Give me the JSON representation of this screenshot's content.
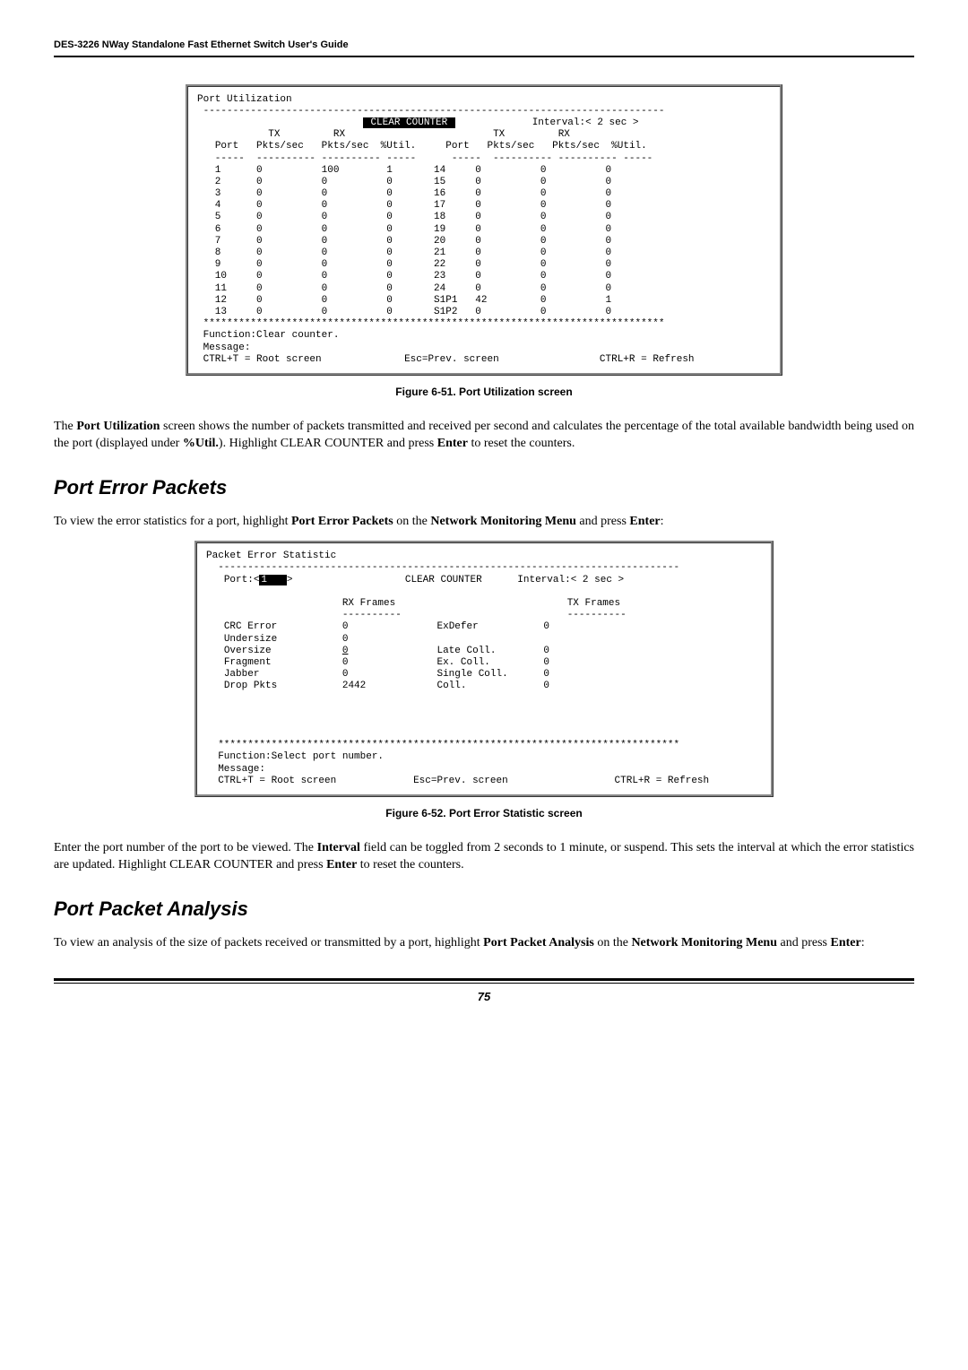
{
  "header": "DES-3226 NWay Standalone Fast Ethernet Switch User's Guide",
  "terminal1": {
    "title": "Port Utilization",
    "hdr_clear": " CLEAR COUNTER ",
    "hdr_interval": "Interval:< 2 sec >",
    "col_tx": "TX",
    "col_rx": "RX",
    "col_port": "Port",
    "col_pktssec": "Pkts/sec",
    "col_util": "%Util.",
    "rows_left": [
      {
        "p": "1",
        "tx": "0",
        "rx": "100",
        "u": "1"
      },
      {
        "p": "2",
        "tx": "0",
        "rx": "0",
        "u": "0"
      },
      {
        "p": "3",
        "tx": "0",
        "rx": "0",
        "u": "0"
      },
      {
        "p": "4",
        "tx": "0",
        "rx": "0",
        "u": "0"
      },
      {
        "p": "5",
        "tx": "0",
        "rx": "0",
        "u": "0"
      },
      {
        "p": "6",
        "tx": "0",
        "rx": "0",
        "u": "0"
      },
      {
        "p": "7",
        "tx": "0",
        "rx": "0",
        "u": "0"
      },
      {
        "p": "8",
        "tx": "0",
        "rx": "0",
        "u": "0"
      },
      {
        "p": "9",
        "tx": "0",
        "rx": "0",
        "u": "0"
      },
      {
        "p": "10",
        "tx": "0",
        "rx": "0",
        "u": "0"
      },
      {
        "p": "11",
        "tx": "0",
        "rx": "0",
        "u": "0"
      },
      {
        "p": "12",
        "tx": "0",
        "rx": "0",
        "u": "0"
      },
      {
        "p": "13",
        "tx": "0",
        "rx": "0",
        "u": "0"
      }
    ],
    "rows_right": [
      {
        "p": "14",
        "tx": "0",
        "rx": "0",
        "u": "0"
      },
      {
        "p": "15",
        "tx": "0",
        "rx": "0",
        "u": "0"
      },
      {
        "p": "16",
        "tx": "0",
        "rx": "0",
        "u": "0"
      },
      {
        "p": "17",
        "tx": "0",
        "rx": "0",
        "u": "0"
      },
      {
        "p": "18",
        "tx": "0",
        "rx": "0",
        "u": "0"
      },
      {
        "p": "19",
        "tx": "0",
        "rx": "0",
        "u": "0"
      },
      {
        "p": "20",
        "tx": "0",
        "rx": "0",
        "u": "0"
      },
      {
        "p": "21",
        "tx": "0",
        "rx": "0",
        "u": "0"
      },
      {
        "p": "22",
        "tx": "0",
        "rx": "0",
        "u": "0"
      },
      {
        "p": "23",
        "tx": "0",
        "rx": "0",
        "u": "0"
      },
      {
        "p": "24",
        "tx": "0",
        "rx": "0",
        "u": "0"
      },
      {
        "p": "S1P1",
        "tx": "42",
        "rx": "0",
        "u": "1"
      },
      {
        "p": "S1P2",
        "tx": "0",
        "rx": "0",
        "u": "0"
      }
    ],
    "func": "Function:Clear counter.",
    "msg": "Message:",
    "foot_left": "CTRL+T = Root screen",
    "foot_mid": "Esc=Prev. screen",
    "foot_right": "CTRL+R = Refresh"
  },
  "caption1": "Figure 6-51.  Port Utilization screen",
  "para1a": "The ",
  "para1b": "Port Utilization",
  "para1c": " screen shows the number of packets transmitted and received per second and calculates the percentage of the total available bandwidth being used on the port (displayed under ",
  "para1d": "%Util.",
  "para1e": "). Highlight CLEAR COUNTER and press ",
  "para1f": "Enter",
  "para1g": " to reset the counters.",
  "section1": "Port Error Packets",
  "para2a": "To view the error statistics for a port, highlight ",
  "para2b": "Port Error Packets",
  "para2c": " on the ",
  "para2d": "Network Monitoring Menu",
  "para2e": " and press ",
  "para2f": "Enter",
  "para2g": ":",
  "terminal2": {
    "title": "Packet Error Statistic",
    "port_label": "Port:<",
    "port_val": "1   ",
    "port_close": ">",
    "clear": "CLEAR COUNTER",
    "interval": "Interval:< 2 sec >",
    "rx_frames": "RX Frames",
    "tx_frames": "TX Frames",
    "rx_dash": "----------",
    "tx_dash": "----------",
    "r1a": "CRC Error",
    "r1b": "0",
    "r1c": "ExDefer",
    "r1d": "0",
    "r2a": "Undersize",
    "r2b": "0",
    "r3a": "Oversize",
    "r3b": "0",
    "r3c": "Late Coll.",
    "r3d": "0",
    "r4a": "Fragment",
    "r4b": "0",
    "r4c": "Ex. Coll.",
    "r4d": "0",
    "r5a": "Jabber",
    "r5b": "0",
    "r5c": "Single Coll.",
    "r5d": "0",
    "r6a": "Drop Pkts",
    "r6b": "2442",
    "r6c": "Coll.",
    "r6d": "0",
    "func": "Function:Select port number.",
    "msg": "Message:",
    "foot_left": "CTRL+T = Root screen",
    "foot_mid": "Esc=Prev. screen",
    "foot_right": "CTRL+R = Refresh"
  },
  "caption2": "Figure 6-52.  Port Error Statistic screen",
  "para3a": "Enter the port number of the port to be viewed. The ",
  "para3b": "Interval",
  "para3c": " field can be toggled from 2 seconds to 1 minute, or suspend. This sets the interval at which the error statistics are updated. Highlight CLEAR COUNTER and press ",
  "para3d": "Enter",
  "para3e": " to reset the counters.",
  "section2": "Port Packet Analysis",
  "para4a": "To view an analysis of the size of packets received or transmitted by a port, highlight ",
  "para4b": "Port Packet Analysis",
  "para4c": " on the ",
  "para4d": "Network Monitoring Menu",
  "para4e": " and press ",
  "para4f": "Enter",
  "para4g": ":",
  "page": "75"
}
